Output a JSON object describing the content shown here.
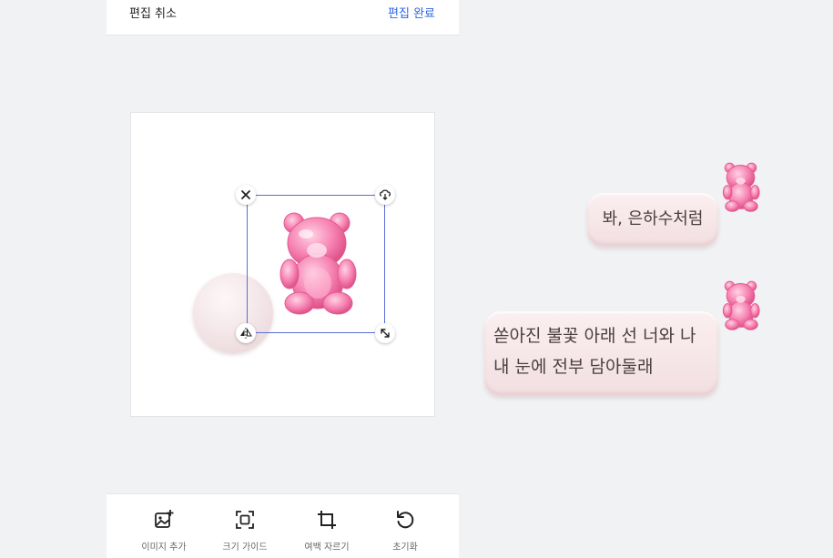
{
  "header": {
    "cancel_label": "편집 취소",
    "done_label": "편집 완료"
  },
  "toolbar": [
    {
      "label": "이미지 추가",
      "icon": "image-add-icon"
    },
    {
      "label": "크기 가이드",
      "icon": "size-guide-icon"
    },
    {
      "label": "여백 자르기",
      "icon": "crop-icon"
    },
    {
      "label": "초기화",
      "icon": "reset-icon"
    }
  ],
  "chat": {
    "bubble1": "봐, 은하수처럼",
    "bubble2_line1": "쏟아진 불꽃 아래 선 너와 나",
    "bubble2_line2": "내 눈에 전부 담아둘래"
  },
  "colors": {
    "accent": "#2c63e6",
    "selection": "#5a6fd8",
    "bear": "#f06aa0",
    "bubble": "#f6e4e6"
  }
}
